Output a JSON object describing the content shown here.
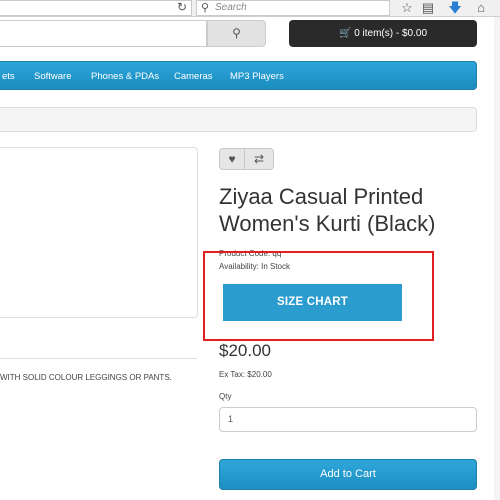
{
  "browser": {
    "search_placeholder": "Search",
    "icons": [
      "reload-icon",
      "search-icon",
      "star-icon",
      "reader-icon",
      "download-icon",
      "home-icon"
    ]
  },
  "header": {
    "cart_label": "0 item(s) - $0.00"
  },
  "menu": {
    "items": [
      "ets",
      "Software",
      "Phones & PDAs",
      "Cameras",
      "MP3 Players"
    ]
  },
  "product": {
    "description": "WITH SOLID COLOUR LEGGINGS OR PANTS.",
    "title": "Ziyaa Casual Printed Women's Kurti (Black)",
    "code_label": "Product Code: qq",
    "availability": "Availability: In Stock",
    "size_chart_label": "SIZE CHART",
    "price": "$20.00",
    "ex_tax": "Ex Tax: $20.00",
    "qty_label": "Qty",
    "qty_value": "1",
    "add_to_cart_label": "Add to Cart"
  },
  "colors": {
    "accent": "#2a9ccd",
    "highlight": "#e02020",
    "cart_bg": "#2a2a2a"
  }
}
